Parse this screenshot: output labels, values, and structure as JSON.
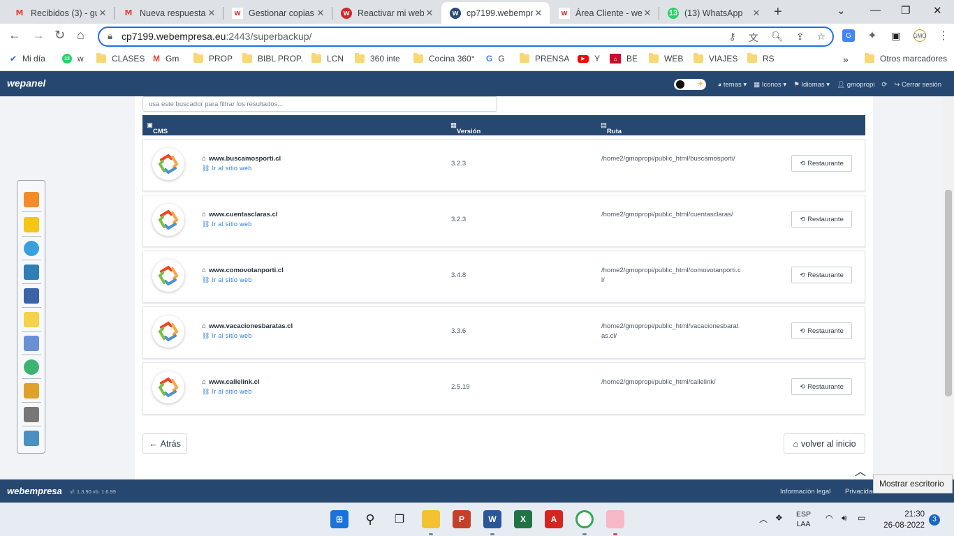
{
  "browser": {
    "tabs": [
      {
        "title": "Recibidos (3) - gu",
        "favicon": "gmail-icon"
      },
      {
        "title": "Nueva respuesta",
        "favicon": "gmail-icon"
      },
      {
        "title": "Gestionar copias",
        "favicon": "webempresa-icon"
      },
      {
        "title": "Reactivar mi web",
        "favicon": "webempresa-icon"
      },
      {
        "title": "cp7199.webempr",
        "favicon": "wepanel-icon"
      },
      {
        "title": "Área Cliente - we",
        "favicon": "webempresa-icon"
      },
      {
        "title": "(13) WhatsApp",
        "favicon": "whatsapp-icon"
      }
    ],
    "url_host": "cp7199.webempresa.eu",
    "url_rest": ":2443/superbackup/",
    "bookmarks": [
      "Mi día",
      "w",
      "CLASES",
      "Gm",
      "PROP",
      "BIBL PROP.",
      "LCN",
      "360 inte",
      "Cocina 360°",
      "G",
      "PRENSA",
      "Y",
      "BE",
      "WEB",
      "VIAJES",
      "RS"
    ],
    "bookmarks_overflow": "»",
    "other_bookmarks": "Otros marcadores",
    "whatsapp_badge": "13",
    "profile_badge": "GMO"
  },
  "header": {
    "logo": "wepanel",
    "menu": [
      "temas",
      "Iconos",
      "Idiomas",
      "gmopropi",
      "Cerrar sesión"
    ]
  },
  "search": {
    "placeholder": "usa este buscador para filtrar los resultados..."
  },
  "table": {
    "columns": [
      "CMS",
      "Versión",
      "Ruta"
    ],
    "visit_label": "Ir al sitio web",
    "restore_label": "Restaurante",
    "rows": [
      {
        "site": "www.buscamosporti.cl",
        "version": "3.2.3",
        "path": "/home2/gmopropi/public_html/buscamosporti/"
      },
      {
        "site": "www.cuentasclaras.cl",
        "version": "3.2.3",
        "path": "/home2/gmopropi/public_html/cuentasclaras/"
      },
      {
        "site": "www.comovotanporti.cl",
        "version": "3.4.8",
        "path": "/home2/gmopropi/public_html/comovotanporti.cl/"
      },
      {
        "site": "www.vacacionesbaratas.cl",
        "version": "3.3.6",
        "path": "/home2/gmopropi/public_html/vacacionesbaratas.cl/"
      },
      {
        "site": "www.callelink.cl",
        "version": "2.5.19",
        "path": "/home2/gmopropi/public_html/callelink/"
      }
    ]
  },
  "nav": {
    "back": "Atrás",
    "home": "volver al inicio"
  },
  "footer": {
    "logo": "webempresa",
    "version": "vf: 1.3.90 vb: 1.6.99",
    "links": [
      "Información legal",
      "Privacidad"
    ],
    "tooltip": "Mostrar escritorio"
  },
  "taskbar": {
    "lang": "ESP",
    "lang_sub": "LAA",
    "time": "21:30",
    "date": "26-08-2022",
    "notifications": "3"
  }
}
